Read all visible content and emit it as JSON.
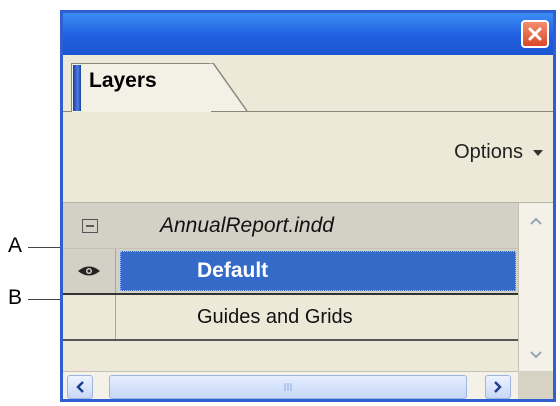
{
  "panel": {
    "tab_label": "Layers",
    "options_label": "Options",
    "document_name": "AnnualReport.indd",
    "layers": [
      {
        "name": "Default",
        "visible": true,
        "selected": true
      },
      {
        "name": "Guides and Grids",
        "visible": false,
        "selected": false
      }
    ]
  },
  "callouts": {
    "a": "A",
    "b": "B"
  },
  "icons": {
    "close": "close-icon",
    "menu": "chevron-down-icon",
    "collapse": "minus-box-icon",
    "visibility": "eye-icon",
    "scroll_up": "chevron-up-icon",
    "scroll_down": "chevron-down-icon",
    "scroll_left": "chevron-left-icon",
    "scroll_right": "chevron-right-icon",
    "grip": "grip-icon"
  },
  "colors": {
    "titlebar": "#1f60e0",
    "selection": "#356ac8",
    "panel_bg": "#ece9d8"
  }
}
